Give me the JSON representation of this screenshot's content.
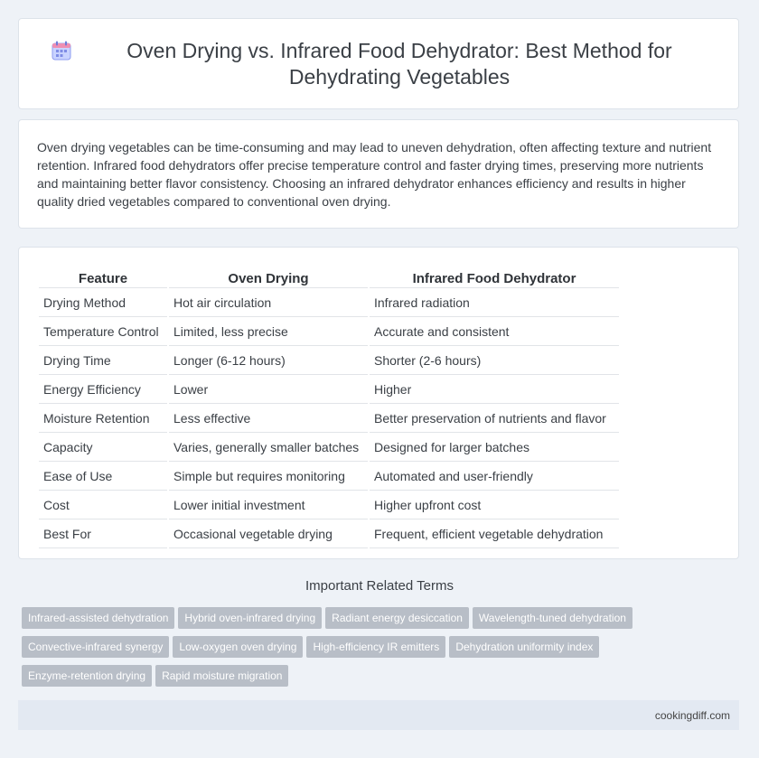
{
  "header": {
    "title": "Oven Drying vs. Infrared Food Dehydrator: Best Method for Dehydrating Vegetables",
    "icon": "calendar-icon"
  },
  "summary": {
    "text": "Oven drying vegetables can be time-consuming and may lead to uneven dehydration, often affecting texture and nutrient retention. Infrared food dehydrators offer precise temperature control and faster drying times, preserving more nutrients and maintaining better flavor consistency. Choosing an infrared dehydrator enhances efficiency and results in higher quality dried vegetables compared to conventional oven drying."
  },
  "table": {
    "headers": [
      "Feature",
      "Oven Drying",
      "Infrared Food Dehydrator"
    ],
    "rows": [
      [
        "Drying Method",
        "Hot air circulation",
        "Infrared radiation"
      ],
      [
        "Temperature Control",
        "Limited, less precise",
        "Accurate and consistent"
      ],
      [
        "Drying Time",
        "Longer (6-12 hours)",
        "Shorter (2-6 hours)"
      ],
      [
        "Energy Efficiency",
        "Lower",
        "Higher"
      ],
      [
        "Moisture Retention",
        "Less effective",
        "Better preservation of nutrients and flavor"
      ],
      [
        "Capacity",
        "Varies, generally smaller batches",
        "Designed for larger batches"
      ],
      [
        "Ease of Use",
        "Simple but requires monitoring",
        "Automated and user-friendly"
      ],
      [
        "Cost",
        "Lower initial investment",
        "Higher upfront cost"
      ],
      [
        "Best For",
        "Occasional vegetable drying",
        "Frequent, efficient vegetable dehydration"
      ]
    ]
  },
  "related": {
    "heading": "Important Related Terms",
    "tags": [
      "Infrared-assisted dehydration",
      "Hybrid oven-infrared drying",
      "Radiant energy desiccation",
      "Wavelength-tuned dehydration",
      "Convective-infrared synergy",
      "Low-oxygen oven drying",
      "High-efficiency IR emitters",
      "Dehydration uniformity index",
      "Enzyme-retention drying",
      "Rapid moisture migration"
    ]
  },
  "footer": {
    "site": "cookingdiff.com"
  },
  "colors": {
    "background": "#eef2f7",
    "tag": "#b8bec7",
    "footer": "#e3e9f2"
  }
}
